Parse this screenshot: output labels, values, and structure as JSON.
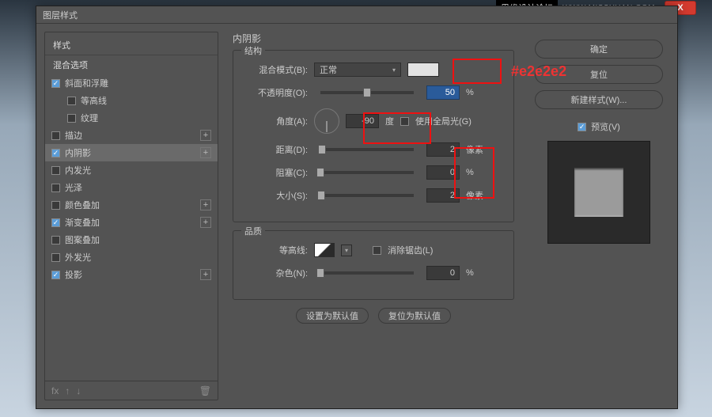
{
  "watermark": {
    "name": "思缘设计论坛",
    "url": "WWW.MISSYUAN.COM",
    "close": "X"
  },
  "window_title": "图层样式",
  "left": {
    "head1": "样式",
    "head2": "混合选项",
    "items": [
      {
        "label": "斜面和浮雕",
        "checked": true,
        "plus": false
      },
      {
        "label": "等高线",
        "checked": false,
        "plus": false,
        "sub": true
      },
      {
        "label": "纹理",
        "checked": false,
        "plus": false,
        "sub": true
      },
      {
        "label": "描边",
        "checked": false,
        "plus": true
      },
      {
        "label": "内阴影",
        "checked": true,
        "plus": true,
        "active": true
      },
      {
        "label": "内发光",
        "checked": false,
        "plus": false
      },
      {
        "label": "光泽",
        "checked": false,
        "plus": false
      },
      {
        "label": "颜色叠加",
        "checked": false,
        "plus": true
      },
      {
        "label": "渐变叠加",
        "checked": true,
        "plus": true
      },
      {
        "label": "图案叠加",
        "checked": false,
        "plus": false
      },
      {
        "label": "外发光",
        "checked": false,
        "plus": false
      },
      {
        "label": "投影",
        "checked": true,
        "plus": true
      }
    ],
    "footer_fx": "fx"
  },
  "mid": {
    "title": "内阴影",
    "g1": "结构",
    "blend_label": "混合模式(B):",
    "blend_value": "正常",
    "hex_note": "#e2e2e2",
    "opacity_label": "不透明度(O):",
    "opacity_value": "50",
    "opacity_unit": "%",
    "angle_label": "角度(A):",
    "angle_value": "-90",
    "angle_unit": "度",
    "global_light": "使用全局光(G)",
    "dist_label": "距离(D):",
    "dist_value": "2",
    "dist_unit": "像素",
    "choke_label": "阻塞(C):",
    "choke_value": "0",
    "choke_unit": "%",
    "size_label": "大小(S):",
    "size_value": "2",
    "size_unit": "像素",
    "g2": "品质",
    "contour_label": "等高线:",
    "aa_label": "消除锯齿(L)",
    "noise_label": "杂色(N):",
    "noise_value": "0",
    "noise_unit": "%",
    "default_set": "设置为默认值",
    "default_reset": "复位为默认值"
  },
  "right": {
    "ok": "确定",
    "cancel": "复位",
    "new_style": "新建样式(W)...",
    "preview": "预览(V)"
  }
}
